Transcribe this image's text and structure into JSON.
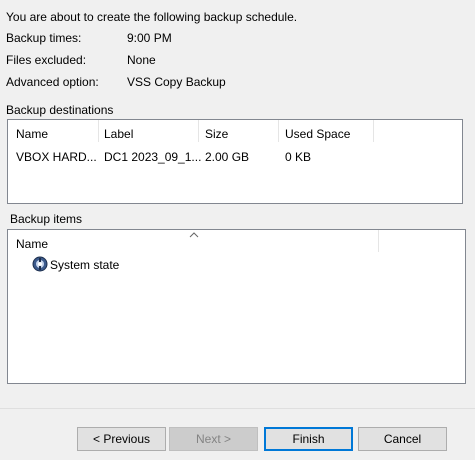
{
  "intro": "You are about to create the following backup schedule.",
  "details": [
    {
      "label": "Backup times:",
      "value": "9:00 PM"
    },
    {
      "label": "Files excluded:",
      "value": "None"
    },
    {
      "label": "Advanced option:",
      "value": "VSS Copy Backup"
    }
  ],
  "destinations": {
    "title": "Backup destinations",
    "columns": [
      "Name",
      "Label",
      "Size",
      "Used Space"
    ],
    "rows": [
      {
        "name": "VBOX HARD...",
        "label": "DC1 2023_09_1...",
        "size": "2.00 GB",
        "used": "0 KB"
      }
    ]
  },
  "items": {
    "title": "Backup items",
    "columns": [
      "Name"
    ],
    "rows": [
      {
        "name": "System state",
        "icon": "system-state-icon"
      }
    ]
  },
  "buttons": {
    "previous": "< Previous",
    "next": "Next >",
    "finish": "Finish",
    "cancel": "Cancel"
  }
}
